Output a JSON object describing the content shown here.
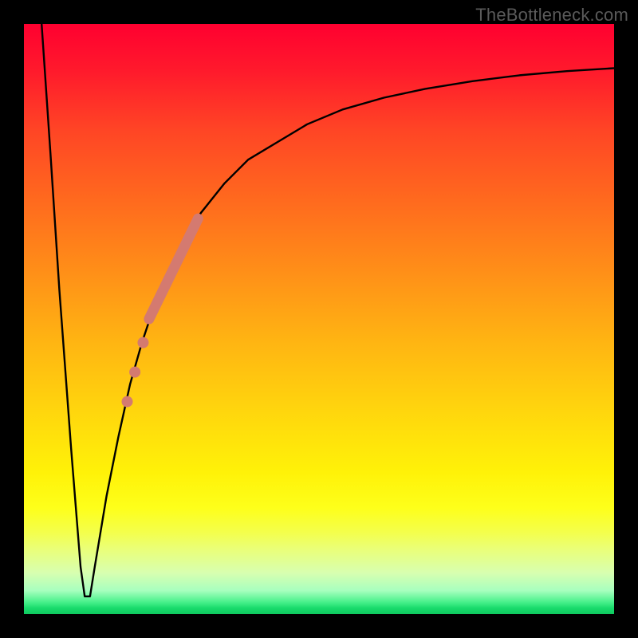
{
  "watermark": "TheBottleneck.com",
  "chart_data": {
    "type": "line",
    "title": "",
    "xlabel": "",
    "ylabel": "",
    "xlim": [
      0,
      100
    ],
    "ylim": [
      0,
      100
    ],
    "grid": false,
    "legend": false,
    "background_gradient_stops": [
      {
        "pos": 0.0,
        "color": "#ff0030"
      },
      {
        "pos": 0.3,
        "color": "#ff6a1e"
      },
      {
        "pos": 0.66,
        "color": "#ffd70d"
      },
      {
        "pos": 0.86,
        "color": "#f4ff4a"
      },
      {
        "pos": 1.0,
        "color": "#0fc95f"
      }
    ],
    "series": [
      {
        "name": "curve",
        "color": "#000000",
        "stroke_width": 2.4,
        "x": [
          3,
          4.5,
          6,
          8,
          9.6,
          10.3,
          11.2,
          12,
          13,
          14,
          16,
          18,
          20,
          22,
          24,
          27,
          30,
          34,
          38,
          43,
          48,
          54,
          61,
          68,
          76,
          84,
          92,
          100
        ],
        "y": [
          100,
          78,
          55,
          28,
          8,
          3,
          3,
          8,
          14,
          20,
          30,
          39,
          46,
          52,
          57,
          63,
          68,
          73,
          77,
          80,
          83,
          85.5,
          87.5,
          89,
          90.3,
          91.3,
          92,
          92.5
        ]
      }
    ],
    "highlight_segment": {
      "name": "thick-salmon-band",
      "color": "#d47a70",
      "stroke_width": 13,
      "x": [
        21.2,
        29.5
      ],
      "y": [
        50.0,
        67.0
      ]
    },
    "highlight_dots": {
      "name": "salmon-dots",
      "color": "#d47a70",
      "radius": 7,
      "points": [
        {
          "x": 17.5,
          "y": 36.0
        },
        {
          "x": 18.8,
          "y": 41.0
        },
        {
          "x": 20.2,
          "y": 46.0
        }
      ]
    }
  }
}
